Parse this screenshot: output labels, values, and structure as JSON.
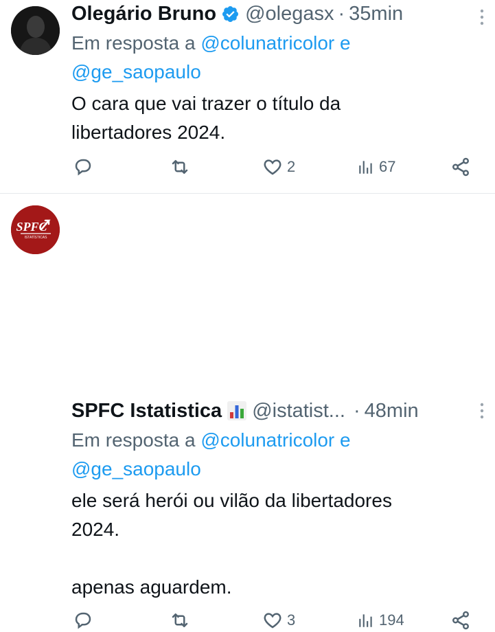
{
  "tweets": [
    {
      "name": "Olegário Bruno",
      "handle": "@olegasx",
      "dot": "·",
      "time": "35min",
      "reply_prefix": "Em resposta a",
      "mention1": "@colunatricolor",
      "reply_join": "e",
      "mention2": "@ge_saopaulo",
      "text": "O cara que vai trazer o título da\nlibertadores 2024.",
      "likes": "2",
      "views": "67",
      "verified": true
    },
    {
      "name": "SPFC Istatistica",
      "handle": "@istatist...",
      "dot": "·",
      "time": "48min",
      "reply_prefix": "Em resposta a",
      "mention1": "@colunatricolor",
      "reply_join": "e",
      "mention2": "@ge_saopaulo",
      "text": "ele será herói ou vilão da libertadores\n2024.\n\napenas aguardem.",
      "likes": "3",
      "views": "194",
      "avatar_text": "SPFC",
      "avatar_subtext": "ISTATÍSTICAS"
    }
  ],
  "icons": {
    "verified": "verified-badge-icon",
    "chart": "bar-chart-emoji-icon",
    "more": "more-vertical-icon",
    "reply": "reply-icon",
    "retweet": "retweet-icon",
    "like": "heart-icon",
    "views": "views-icon",
    "share": "share-icon"
  },
  "colors": {
    "link": "#1d9bf0",
    "secondary": "#536471",
    "text": "#0f1419",
    "verified": "#1d9bf0",
    "spfc_red": "#a31818"
  }
}
